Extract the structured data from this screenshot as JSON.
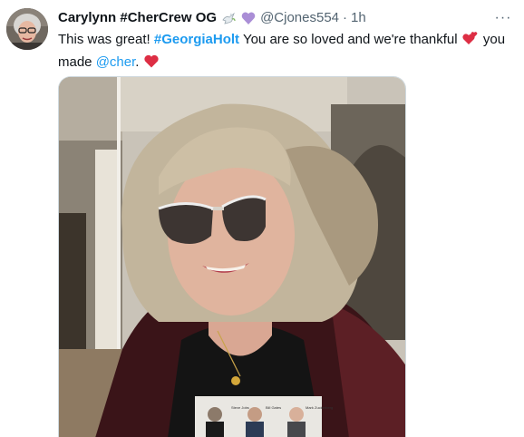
{
  "tweet": {
    "author": {
      "display_name": "Carylynn #CherCrew OG",
      "badges": [
        "dove-emoji",
        "purple-heart-emoji"
      ],
      "handle": "@Cjones554",
      "time": "1h",
      "separator": "·"
    },
    "text": {
      "part1": "This was great! ",
      "hashtag": "#GeorgiaHolt",
      "part2": " You are so loved and we're thankful ",
      "part3": " you made ",
      "mention": "@cher",
      "part4": ". "
    },
    "more_label": "···",
    "media": {
      "shirt_photo_labels": [
        "Steve Jobs",
        "Bill Gates",
        "Mark Zuckerberg"
      ]
    }
  },
  "colors": {
    "link": "#1d9bf0",
    "secondary_text": "#536471",
    "heart_red": "#e0245e",
    "purple_heart": "#aa8ed6"
  }
}
